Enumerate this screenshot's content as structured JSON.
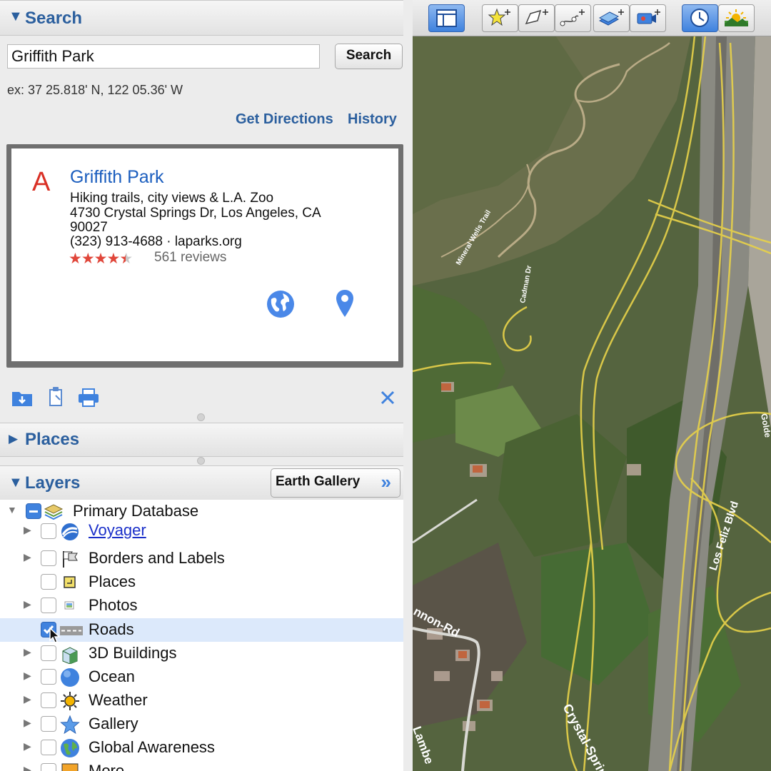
{
  "search": {
    "section_title": "Search",
    "query": "Griffith Park",
    "button_label": "Search",
    "example": "ex: 37 25.818' N, 122 05.36' W",
    "get_directions": "Get Directions",
    "history": "History"
  },
  "result": {
    "marker": "A",
    "name": "Griffith Park",
    "description": "Hiking trails, city views & L.A. Zoo",
    "address_line1": "4730 Crystal Springs Dr, Los Angeles, CA",
    "address_line2": "90027",
    "contact": "(323) 913-4688 · laparks.org",
    "rating": 4.5,
    "stars": "★★★★★",
    "reviews": "561 reviews",
    "actions": [
      "globe-icon",
      "location-pin-icon"
    ]
  },
  "result_toolbar": {
    "icons": [
      "save-to-places-icon",
      "copy-icon",
      "print-icon",
      "close-icon"
    ]
  },
  "places": {
    "section_title": "Places"
  },
  "layers": {
    "section_title": "Layers",
    "gallery_button": "Earth Gallery",
    "gallery_chevron": "»",
    "items": [
      {
        "label": "Primary Database",
        "icon": "database-icon",
        "state": "partial",
        "expandable": true,
        "expanded": true
      },
      {
        "label": "Voyager",
        "icon": "voyager-icon",
        "state": "unchecked",
        "expandable": true,
        "link": true
      },
      {
        "label": "Borders and Labels",
        "icon": "flags-icon",
        "state": "unchecked",
        "expandable": true
      },
      {
        "label": "Places",
        "icon": "places-layer-icon",
        "state": "unchecked",
        "expandable": false
      },
      {
        "label": "Photos",
        "icon": "photos-icon",
        "state": "unchecked",
        "expandable": true
      },
      {
        "label": "Roads",
        "icon": "roads-icon",
        "state": "checked",
        "expandable": false,
        "selected": true
      },
      {
        "label": "3D Buildings",
        "icon": "buildings-icon",
        "state": "unchecked",
        "expandable": true
      },
      {
        "label": "Ocean",
        "icon": "ocean-icon",
        "state": "unchecked",
        "expandable": true
      },
      {
        "label": "Weather",
        "icon": "weather-icon",
        "state": "unchecked",
        "expandable": true
      },
      {
        "label": "Gallery",
        "icon": "gallery-star-icon",
        "state": "unchecked",
        "expandable": true
      },
      {
        "label": "Global Awareness",
        "icon": "globe-layer-icon",
        "state": "unchecked",
        "expandable": true
      },
      {
        "label": "More",
        "icon": "more-icon",
        "state": "unchecked",
        "expandable": true
      }
    ]
  },
  "toolbar": {
    "buttons": [
      "sidebar-toggle-icon",
      "add-placemark-icon",
      "add-polygon-icon",
      "add-path-icon",
      "add-image-overlay-icon",
      "record-tour-icon",
      "historical-imagery-icon",
      "sunlight-icon"
    ],
    "active": [
      "sidebar-toggle-icon",
      "historical-imagery-icon"
    ]
  },
  "map": {
    "road_labels": [
      "Mineral Wells Trail",
      "Cadman Dr",
      "Los Feliz Blvd",
      "Crystal-Spring",
      "nnon-Rd",
      "Lambe",
      "Golde"
    ]
  },
  "colors": {
    "accent": "#2b5f9e",
    "link": "#1a5dbe",
    "marker": "#d93025",
    "selection": "#dce9fb",
    "road": "#e8d24a"
  }
}
